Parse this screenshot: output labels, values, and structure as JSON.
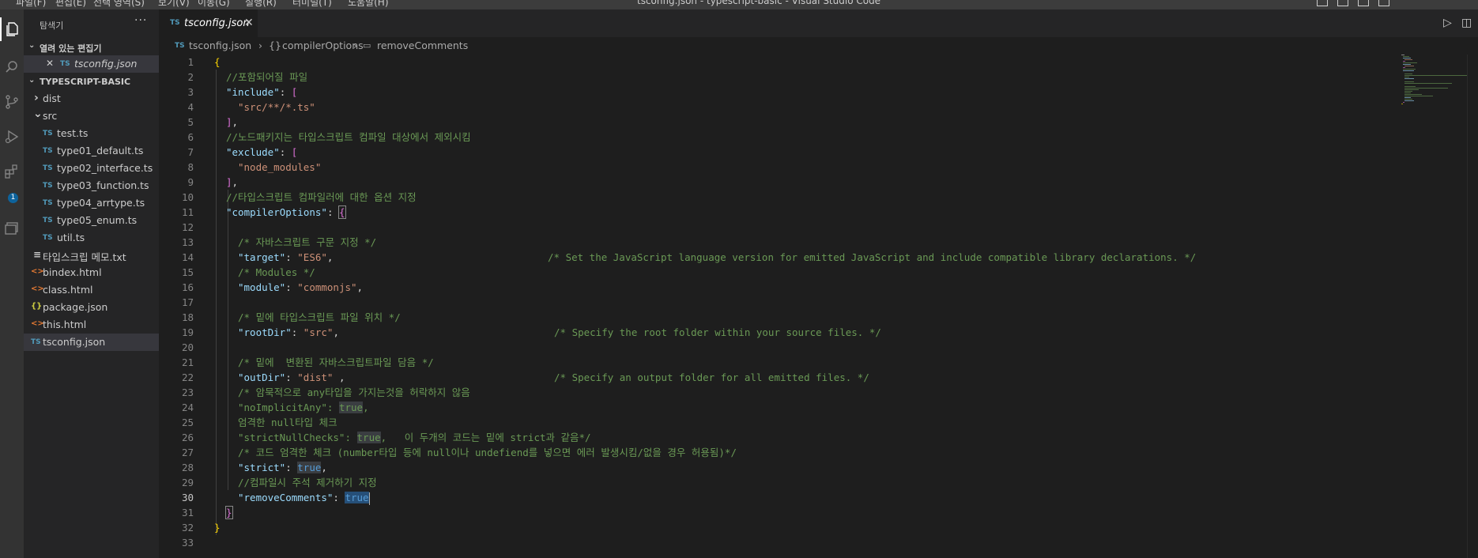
{
  "titlebar": {
    "title": "tsconfig.json - typescript-basic - Visual Studio Code",
    "menu": [
      "파일(F)",
      "편집(E)",
      "선택 영역(S)",
      "보기(V)",
      "이동(G)",
      "실행(R)",
      "터미널(T)",
      "도움말(H)"
    ]
  },
  "activity": {
    "icons": [
      "explorer-icon",
      "search-icon",
      "source-control-icon",
      "run-debug-icon",
      "extensions-icon",
      "remote-explorer-icon"
    ],
    "extensions_badge": "1"
  },
  "sidebar": {
    "title": "탐색기",
    "more": "···",
    "open_editors_label": "열려 있는 편집기",
    "open_editors": [
      {
        "name": "tsconfig.json",
        "icon": "TS"
      }
    ],
    "project_label": "TYPESCRIPT-BASIC",
    "tree": [
      {
        "name": "dist",
        "icon": "›"
      },
      {
        "name": "src",
        "icon": "⌄"
      },
      {
        "name": "test.ts",
        "icon": "TS"
      },
      {
        "name": "type01_default.ts",
        "icon": "TS"
      },
      {
        "name": "type02_interface.ts",
        "icon": "TS"
      },
      {
        "name": "type03_function.ts",
        "icon": "TS"
      },
      {
        "name": "type04_arrtype.ts",
        "icon": "TS"
      },
      {
        "name": "type05_enum.ts",
        "icon": "TS"
      },
      {
        "name": "util.ts",
        "icon": "TS"
      },
      {
        "name": "타입스크립 메모.txt",
        "icon": "≡"
      },
      {
        "name": "bindex.html",
        "icon": "<>"
      },
      {
        "name": "class.html",
        "icon": "<>"
      },
      {
        "name": "package.json",
        "icon": "{}"
      },
      {
        "name": "this.html",
        "icon": "<>"
      },
      {
        "name": "tsconfig.json",
        "icon": "TS"
      }
    ]
  },
  "tabs": [
    {
      "label": "tsconfig.json",
      "icon": "TS",
      "close": "✕"
    }
  ],
  "toolbar": {
    "run": "▷",
    "split": "◫"
  },
  "breadcrumb": {
    "file": "tsconfig.json",
    "sep": "›",
    "obj_icon": "{}",
    "obj": "compilerOptions",
    "prop_icon": "▭",
    "prop": "removeComments"
  },
  "editor": {
    "line_numbers": [
      "1",
      "2",
      "3",
      "4",
      "5",
      "6",
      "7",
      "8",
      "9",
      "10",
      "11",
      "12",
      "13",
      "14",
      "15",
      "16",
      "17",
      "18",
      "19",
      "20",
      "21",
      "22",
      "23",
      "24",
      "25",
      "26",
      "27",
      "28",
      "29",
      "30",
      "31",
      "32",
      "33"
    ],
    "current_line": "30",
    "t": {
      "l1": "{",
      "l2": "//포함되어질 파일",
      "l3k": "\"include\"",
      "l3c": ": ",
      "l3b": "[",
      "l4": "\"src/**/*.ts\"",
      "l5b": "]",
      "l5c": ",",
      "l6": "//노드패키지는 타입스크립트 컴파일 대상에서 제외시킴",
      "l7k": "\"exclude\"",
      "l7c": ": ",
      "l7b": "[",
      "l8": "\"node_modules\"",
      "l9b": "]",
      "l9c": ",",
      "l10": "//타입스크립트 컴파일러에 대한 옵션 지정",
      "l11k": "\"compilerOptions\"",
      "l11c": ": ",
      "l11b": "{",
      "l13": "/* 자바스크립트 구문 지정 */",
      "l14k": "\"target\"",
      "l14c": ": ",
      "l14v": "\"ES6\"",
      "l14p": ",",
      "l14cm": "/* Set the JavaScript language version for emitted JavaScript and include compatible library declarations. */",
      "l15": "/* Modules */",
      "l16k": "\"module\"",
      "l16c": ": ",
      "l16v": "\"commonjs\"",
      "l16p": ",",
      "l18": "/* 밑에 타입스크립트 파일 위치 */",
      "l19k": "\"rootDir\"",
      "l19c": ": ",
      "l19v": "\"src\"",
      "l19p": ",",
      "l19cm": "/* Specify the root folder within your source files. */",
      "l21": "/* 밑에  변환된 자바스크립트파일 담음 */",
      "l22k": "\"outDir\"",
      "l22c": ": ",
      "l22v": "\"dist\"",
      "l22p": " ,",
      "l22cm": "/* Specify an output folder for all emitted files. */",
      "l23": "/* 암묵적으로 any타입을 가지는것을 허락하지 않음",
      "l24k": "\"noImplicitAny\"",
      "l24c": ": ",
      "l24v": "true",
      "l24p": ",",
      "l25": "엄격한 null타입 체크",
      "l26k": "\"strictNullChecks\"",
      "l26c": ": ",
      "l26v": "true",
      "l26p": ",   이 두개의 코드는 밑에 strict과 같음*/",
      "l27": "/* 코드 엄격한 체크 (number타입 등에 null이나 undefiend를 넣으면 에러 발생시킴/없을 경우 허용됨)*/",
      "l28k": "\"strict\"",
      "l28c": ": ",
      "l28v": "true",
      "l28p": ",",
      "l29": "//컴파일시 주석 제거하기 지정",
      "l30k": "\"removeComments\"",
      "l30c": ": ",
      "l30v": "true",
      "l31": "}",
      "l32": "}"
    }
  },
  "colors": {
    "background": "#1e1e1e",
    "sidebar": "#252526",
    "activitybar": "#333333",
    "accent": "#0e639c",
    "string": "#ce9178",
    "key": "#9cdcfe",
    "comment": "#6a9955",
    "keyword": "#569cd6"
  }
}
